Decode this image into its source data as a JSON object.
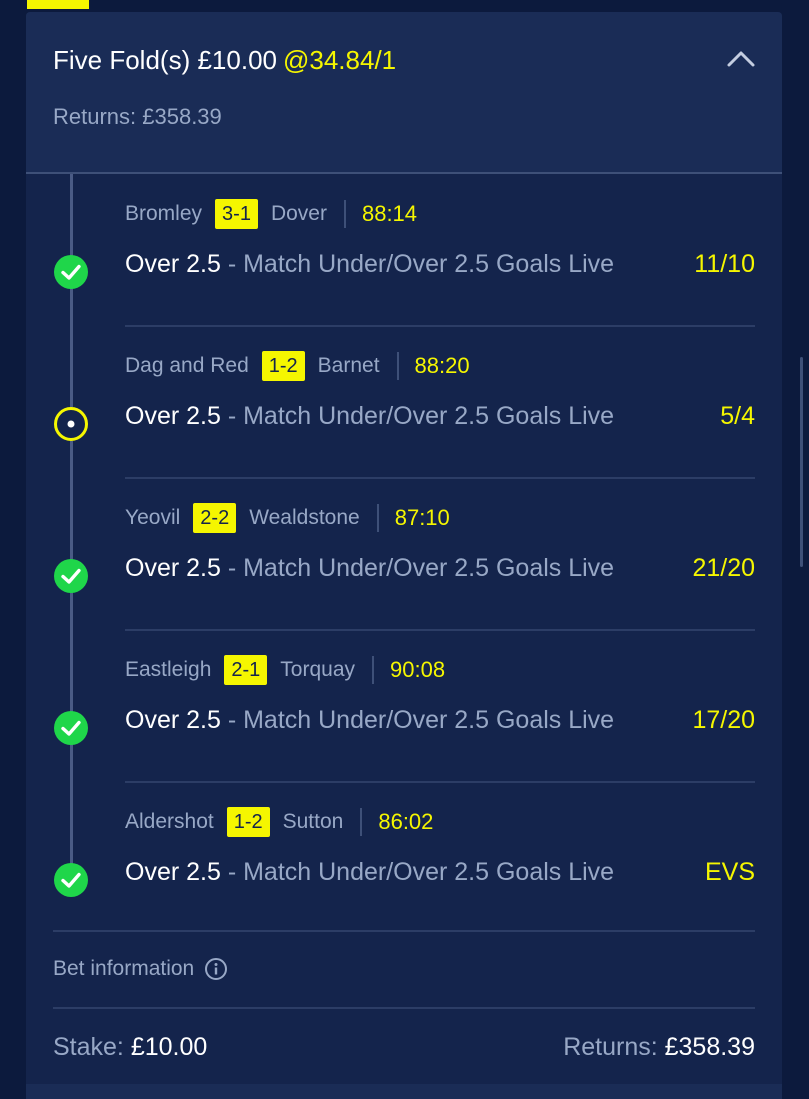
{
  "colors": {
    "background": "#0c1a3d",
    "card": "#14244c",
    "header": "#1a2c56",
    "accent_yellow": "#f5f600",
    "muted_text": "#98a8c6",
    "win_green": "#1fd64a"
  },
  "bet": {
    "title": "Five Fold(s) £10.00",
    "odds": "@34.84/1",
    "returns": "Returns: £358.39",
    "collapse_icon": "chevron-up-icon"
  },
  "legs": [
    {
      "home": "Bromley",
      "score": "3-1",
      "away": "Dover",
      "time": "88:14",
      "selection": "Over 2.5",
      "market": " - Match Under/Over 2.5 Goals Live",
      "odds": "11/10",
      "status": "won"
    },
    {
      "home": "Dag and Red",
      "score": "1-2",
      "away": "Barnet",
      "time": "88:20",
      "selection": "Over 2.5",
      "market": " - Match Under/Over 2.5 Goals Live",
      "odds": "5/4",
      "status": "pending"
    },
    {
      "home": "Yeovil",
      "score": "2-2",
      "away": "Wealdstone",
      "time": "87:10",
      "selection": "Over 2.5",
      "market": " - Match Under/Over 2.5 Goals Live",
      "odds": "21/20",
      "status": "won"
    },
    {
      "home": "Eastleigh",
      "score": "2-1",
      "away": "Torquay",
      "time": "90:08",
      "selection": "Over 2.5",
      "market": " - Match Under/Over 2.5 Goals Live",
      "odds": "17/20",
      "status": "won"
    },
    {
      "home": "Aldershot",
      "score": "1-2",
      "away": "Sutton",
      "time": "86:02",
      "selection": "Over 2.5",
      "market": " - Match Under/Over 2.5 Goals Live",
      "odds": "EVS",
      "status": "won"
    }
  ],
  "footer": {
    "bet_info_label": "Bet information",
    "stake_label": "Stake:",
    "stake_value": "£10.00",
    "returns_label": "Returns:",
    "returns_value": "£358.39"
  }
}
